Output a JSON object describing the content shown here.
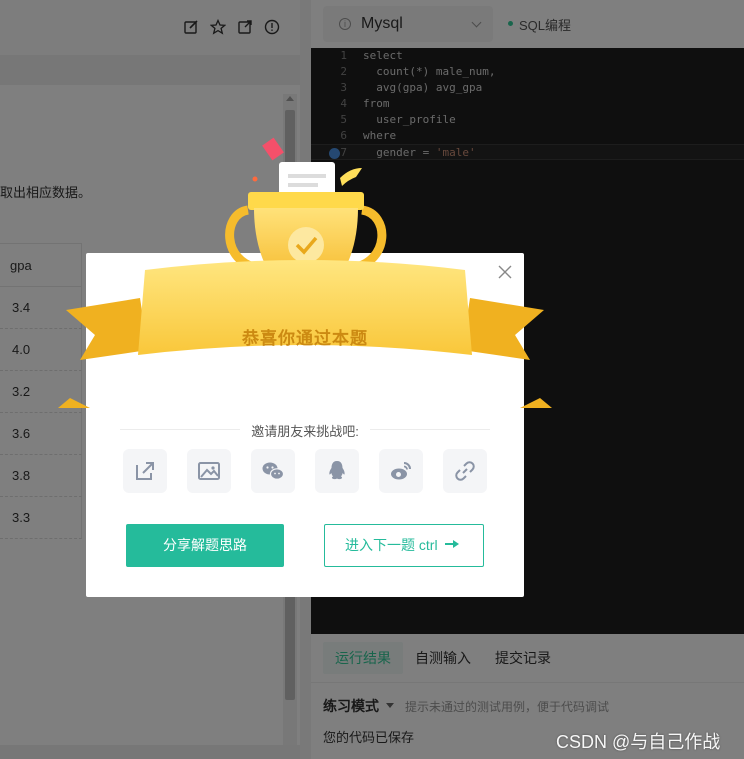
{
  "left_panel": {
    "description_fragment": "取出相应数据。",
    "table": {
      "header": "gpa",
      "rows": [
        "3.4",
        "4.0",
        "3.2",
        "3.6",
        "3.8",
        "3.3"
      ]
    }
  },
  "editor": {
    "language": "Mysql",
    "mode_label": "SQL编程",
    "lines": [
      {
        "num": "1",
        "code": "select"
      },
      {
        "num": "2",
        "code": "  count(*) male_num,"
      },
      {
        "num": "3",
        "code": "  avg(gpa) avg_gpa"
      },
      {
        "num": "4",
        "code": "from"
      },
      {
        "num": "5",
        "code": "  user_profile"
      },
      {
        "num": "6",
        "code": "where"
      },
      {
        "num": "7",
        "code_prefix": "  gender = ",
        "code_string": "'male'"
      }
    ]
  },
  "result_panel": {
    "tabs": [
      "运行结果",
      "自测输入",
      "提交记录"
    ],
    "mode": "练习模式",
    "hint": "提示未通过的测试用例，便于代码调试",
    "status": "您的代码已保存"
  },
  "modal": {
    "banner": "恭喜你通过本题",
    "invite": "邀请朋友来挑战吧:",
    "share_icons": [
      "external-share-icon",
      "image-icon",
      "wechat-icon",
      "qq-icon",
      "weibo-icon",
      "link-icon"
    ],
    "share_button": "分享解题思路",
    "next_button": "进入下一题 ctrl"
  },
  "watermark": "CSDN @与自己作战",
  "colors": {
    "accent": "#25bb9b",
    "trophy_gold": "#f8c53a",
    "ribbon": "#fcd54a",
    "editor_bg": "#1e1e1e"
  }
}
